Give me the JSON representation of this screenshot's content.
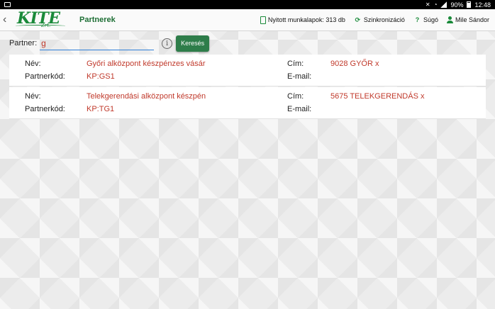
{
  "statusbar": {
    "battery": "90%",
    "time": "12:48"
  },
  "header": {
    "logo_text": "KITE",
    "logo_sub": "Zrt.",
    "title": "Partnerek",
    "open_worksheets_label": "Nyitott munkalapok: 313 db",
    "sync_label": "Szinkronizáció",
    "help_label": "Súgó",
    "user_name": "Mile Sándor"
  },
  "search": {
    "label": "Partner:",
    "value": "g",
    "button_label": "Keresés"
  },
  "results": {
    "labels": {
      "name": "Név:",
      "code": "Partnerkód:",
      "address": "Cím:",
      "email": "E-mail:"
    },
    "items": [
      {
        "name": "Győri alközpont készpénzes vásár",
        "code": "KP:GS1",
        "address": "9028 GYŐR x",
        "email": ""
      },
      {
        "name": "Telekgerendási alközpont készpén",
        "code": "KP:TG1",
        "address": "5675 TELEKGERENDÁS x",
        "email": ""
      }
    ]
  },
  "colors": {
    "brand_green": "#1a8a3a",
    "button_green": "#2e7d4a",
    "value_red": "#c0392b",
    "input_underline": "#2f7fd8"
  }
}
